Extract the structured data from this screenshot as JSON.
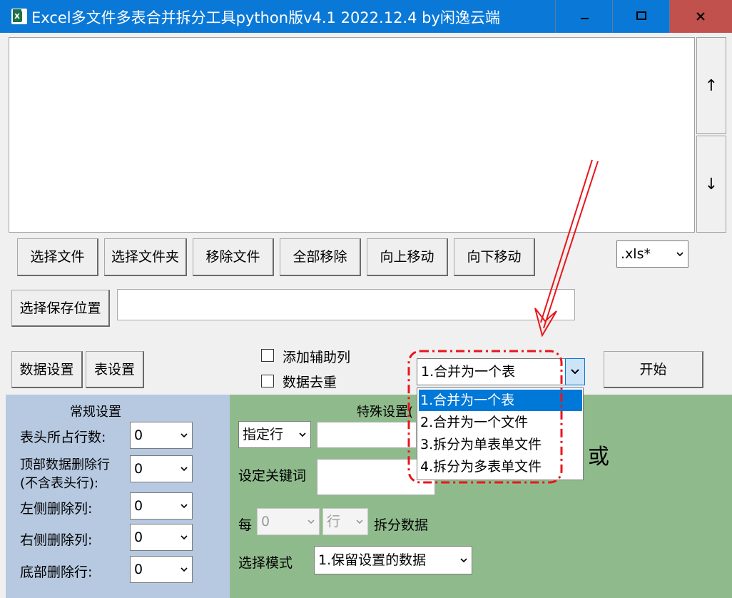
{
  "window": {
    "title": "Excel多文件多表合并拆分工具python版v4.1  2022.12.4 by闲逸云端",
    "min_icon": "minimize-icon",
    "max_icon": "maximize-icon",
    "close_icon": "close-icon"
  },
  "list_controls": {
    "up": "↑",
    "down": "↓"
  },
  "file_buttons": {
    "select_file": "选择文件",
    "select_folder": "选择文件夹",
    "remove_file": "移除文件",
    "remove_all": "全部移除",
    "move_up": "向上移动",
    "move_down": "向下移动"
  },
  "file_filter": {
    "value": ".xls*"
  },
  "save": {
    "button": "选择保存位置",
    "path": ""
  },
  "settings_buttons": {
    "data_settings": "数据设置",
    "sheet_settings": "表设置"
  },
  "checkboxes": {
    "add_helper_column": "添加辅助列",
    "dedupe": "数据去重"
  },
  "mode": {
    "selected": "1.合并为一个表",
    "options": [
      "1.合并为一个表",
      "2.合并为一个文件",
      "3.拆分为单表单文件",
      "4.拆分为多表单文件"
    ]
  },
  "start_button": "开始",
  "general": {
    "title": "常规设置",
    "header_rows_label": "表头所占行数:",
    "header_rows_value": "0",
    "top_delete_label_1": "顶部数据删除行",
    "top_delete_label_2": "(不含表头行):",
    "top_delete_value": "0",
    "left_delete_label": "左侧删除列:",
    "left_delete_value": "0",
    "right_delete_label": "右侧删除列:",
    "right_delete_value": "0",
    "bottom_delete_label": "底部删除行:",
    "bottom_delete_value": "0"
  },
  "special": {
    "title": "特殊设置(",
    "row_select": "指定行",
    "keyword_label": "设定关键词",
    "or_text": "或",
    "every_label": "每",
    "every_value": "0",
    "unit_value": "行",
    "split_label": "拆分数据",
    "mode_label": "选择模式",
    "mode_value": "1.保留设置的数据"
  },
  "colors": {
    "titlebar": "#0a78d7",
    "close": "#c0514d",
    "general_panel": "#b6c9e1",
    "special_panel": "#8fbb8c",
    "highlight": "#0078d7",
    "annotation": "#e8161b"
  }
}
